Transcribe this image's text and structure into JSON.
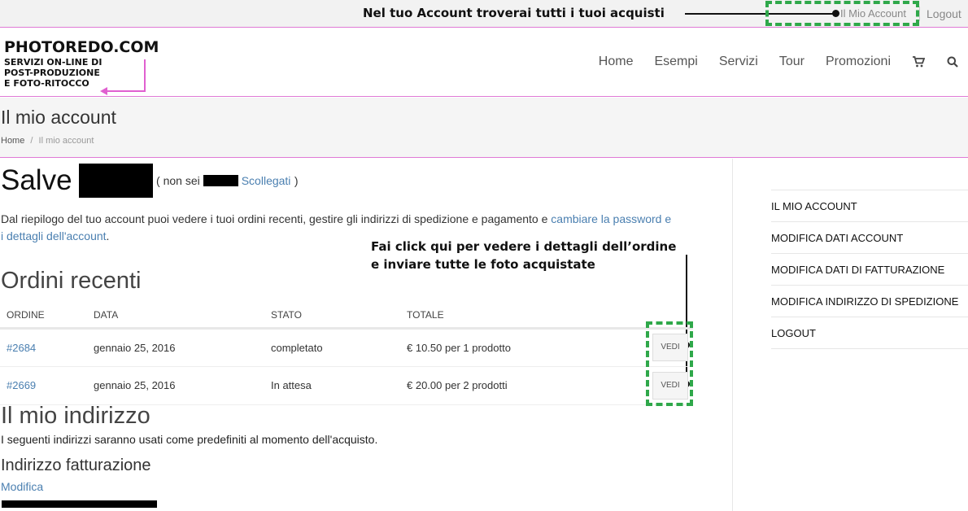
{
  "topbar": {
    "annotation": "Nel tuo Account troverai tutti i tuoi acquisti",
    "account_link": "Il Mio Account",
    "logout": "Logout"
  },
  "header": {
    "brand": "PHOTOREDO.COM",
    "tagline": [
      "SERVIZI ON-LINE DI",
      "POST-PRODUZIONE",
      "E FOTO-RITOCCO"
    ],
    "nav": [
      "Home",
      "Esempi",
      "Servizi",
      "Tour",
      "Promozioni"
    ],
    "icons": [
      "cart-icon",
      "search-icon"
    ]
  },
  "page": {
    "title": "Il mio account",
    "breadcrumb_home": "Home",
    "breadcrumb_sep": "/",
    "breadcrumb_current": "Il mio account"
  },
  "greeting": {
    "salve": "Salve",
    "not_you_prefix": "( non sei",
    "logout_link": "Scollegati",
    "not_you_suffix": ")"
  },
  "intro": {
    "text": "Dal riepilogo del tuo account puoi vedere i tuoi ordini recenti, gestire gli indirizzi di spedizione e pagamento e ",
    "link": "cambiare la password e i dettagli dell'account",
    "end": "."
  },
  "annotation2": [
    "Fai click qui per vedere i dettagli dell’ordine",
    "e inviare tutte le foto acquistate"
  ],
  "orders": {
    "heading": "Ordini recenti",
    "columns": [
      "ORDINE",
      "DATA",
      "STATO",
      "TOTALE"
    ],
    "rows": [
      {
        "order": "#2684",
        "date": "gennaio 25, 2016",
        "status": "completato",
        "total": "€ 10.50 per 1 prodotto",
        "action": "VEDI"
      },
      {
        "order": "#2669",
        "date": "gennaio 25, 2016",
        "status": "In attesa",
        "total": "€ 20.00 per 2 prodotti",
        "action": "VEDI"
      }
    ]
  },
  "address": {
    "heading": "Il mio indirizzo",
    "note": "I seguenti indirizzi saranno usati come predefiniti al momento dell'acquisto.",
    "billing_heading": "Indirizzo fatturazione",
    "edit": "Modifica"
  },
  "sidebar": {
    "items": [
      "IL MIO ACCOUNT",
      "MODIFICA DATI ACCOUNT",
      "MODIFICA DATI DI FATTURAZIONE",
      "MODIFICA INDIRIZZO DI SPEDIZIONE",
      "LOGOUT"
    ]
  },
  "colors": {
    "accent_pink": "#e07ad6",
    "highlight_green": "#2fa84a",
    "link_blue": "#4a7fb0"
  }
}
